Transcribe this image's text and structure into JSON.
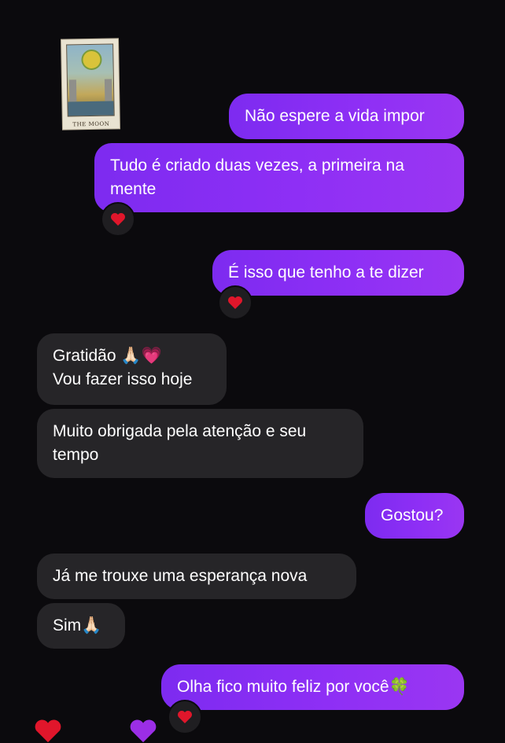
{
  "sticker": {
    "name": "tarot-card-the-moon",
    "label": "THE MOON"
  },
  "messages": [
    {
      "id": "m1",
      "side": "sent",
      "text": "Não espere a vida impor"
    },
    {
      "id": "m2",
      "side": "sent",
      "text": "Tudo é criado duas vezes, a primeira na mente",
      "reaction": "❤️"
    },
    {
      "id": "m3",
      "side": "sent",
      "text": "É isso que tenho a te dizer",
      "reaction": "❤️"
    },
    {
      "id": "m4",
      "side": "received",
      "lines": [
        "Gratidão 🙏🏻💗",
        "Vou fazer isso hoje"
      ]
    },
    {
      "id": "m5",
      "side": "received",
      "text": "Muito obrigada pela atenção e seu tempo"
    },
    {
      "id": "m6",
      "side": "sent",
      "text": "Gostou?"
    },
    {
      "id": "m7",
      "side": "received",
      "text": "Já me trouxe uma esperança nova"
    },
    {
      "id": "m8",
      "side": "received",
      "text": "Sim🙏🏻"
    },
    {
      "id": "m9",
      "side": "sent",
      "text": "Olha fico muito feliz por você🍀",
      "reaction": "❤️"
    }
  ],
  "colors": {
    "background": "#0b0a0d",
    "sent_bubble": "#8a2ff4",
    "received_bubble": "#262528",
    "reaction_bg": "#1f1e21",
    "heart": "#e0162b"
  }
}
